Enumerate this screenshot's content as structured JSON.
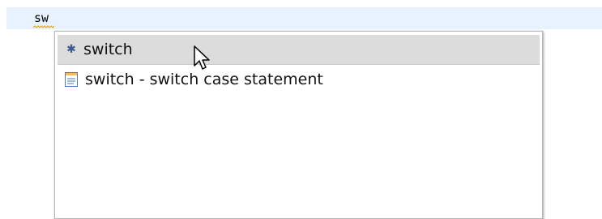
{
  "editor": {
    "typed_text": "sw"
  },
  "completion_popup": {
    "items": [
      {
        "icon": "asterisk-icon",
        "label": "switch"
      },
      {
        "icon": "template-icon",
        "label": "switch - switch case statement"
      }
    ]
  },
  "colors": {
    "line_highlight": "#e8f2fe",
    "selection": "#dcdcdc",
    "squiggle": "#e0a000"
  }
}
